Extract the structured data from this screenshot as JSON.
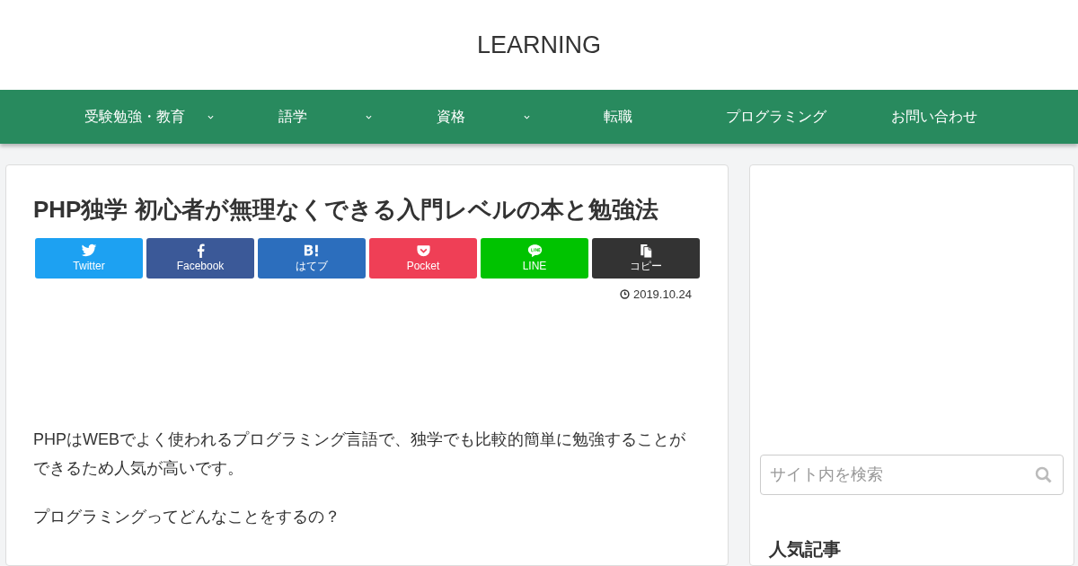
{
  "site_title": "LEARNING",
  "nav": [
    {
      "label": "受験勉強・教育",
      "has_submenu": true
    },
    {
      "label": "語学",
      "has_submenu": true
    },
    {
      "label": "資格",
      "has_submenu": true
    },
    {
      "label": "転職",
      "has_submenu": false
    },
    {
      "label": "プログラミング",
      "has_submenu": false
    },
    {
      "label": "お問い合わせ",
      "has_submenu": false
    }
  ],
  "article": {
    "title": "PHP独学 初心者が無理なくできる入門レベルの本と勉強法",
    "share_buttons": [
      {
        "kind": "twitter",
        "label": "Twitter",
        "color": "#1da1f2"
      },
      {
        "kind": "facebook",
        "label": "Facebook",
        "color": "#3b5998"
      },
      {
        "kind": "hatena",
        "label": "はてブ",
        "color": "#2c6ebd"
      },
      {
        "kind": "pocket",
        "label": "Pocket",
        "color": "#ef3f56"
      },
      {
        "kind": "line",
        "label": "LINE",
        "color": "#00c300"
      },
      {
        "kind": "copy",
        "label": "コピー",
        "color": "#333333"
      }
    ],
    "date": "2019.10.24",
    "paragraphs": [
      "PHPはWEBでよく使われるプログラミング言語で、独学でも比較的簡単に勉強することができるため人気が高いです。",
      "プログラミングってどんなことをするの？"
    ]
  },
  "sidebar": {
    "search": {
      "placeholder": "サイト内を検索"
    },
    "popular_heading": "人気記事"
  }
}
